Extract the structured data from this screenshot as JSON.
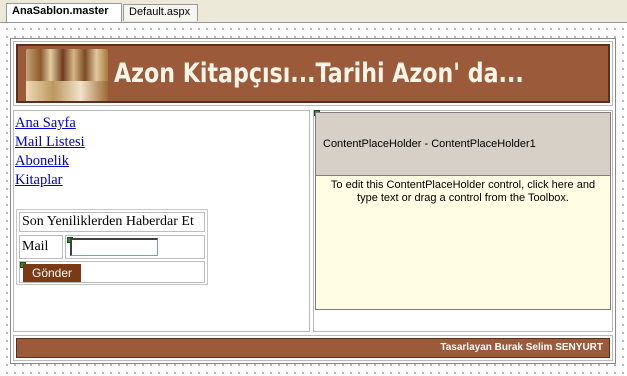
{
  "tabs": [
    {
      "label": "AnaSablon.master",
      "active": true
    },
    {
      "label": "Default.aspx",
      "active": false
    }
  ],
  "banner": {
    "title": "Azon Kitapçısı...Tarihi Azon' da..."
  },
  "nav": {
    "items": [
      "Ana Sayfa",
      "Mail Listesi",
      "Abonelik",
      "Kitaplar"
    ]
  },
  "newsletter": {
    "title": "Son Yeniliklerden Haberdar Et",
    "mail_label": "Mail",
    "mail_value": "",
    "button_label": "Gönder"
  },
  "content_placeholder": {
    "header": "ContentPlaceHolder - ContentPlaceHolder1",
    "hint": "To edit this ContentPlaceHolder control, click here and type text or drag a control from the Toolbox."
  },
  "footer": {
    "text": "Tasarlayan Burak Selim SENYURT"
  },
  "colors": {
    "banner_bg": "#9b5a3a",
    "button_bg": "#7a3a14",
    "placeholder_header_bg": "#d6d0c6",
    "placeholder_body_bg": "#fffee4",
    "link": "#0000cc"
  }
}
